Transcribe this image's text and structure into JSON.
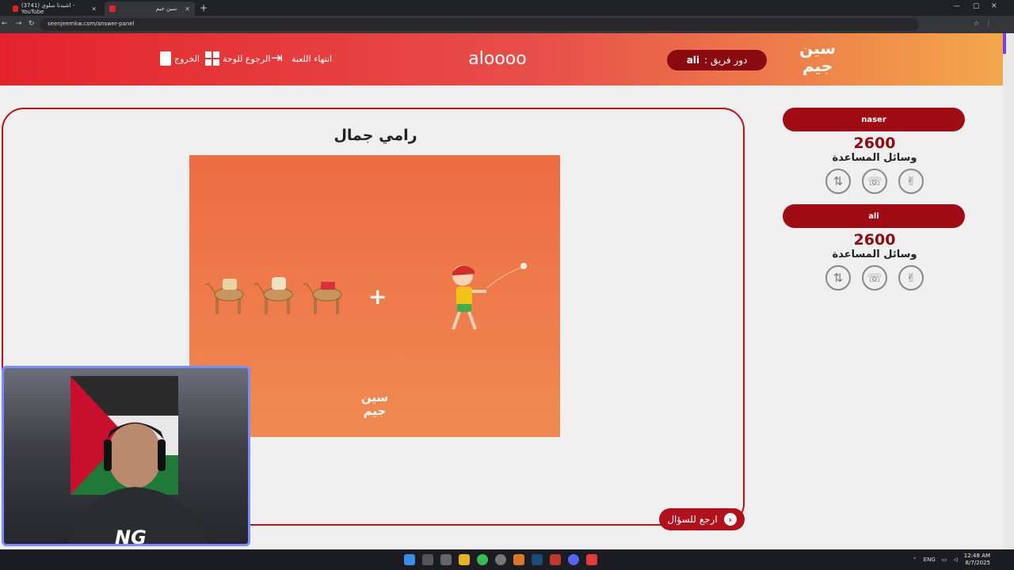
{
  "browser": {
    "tabs": [
      {
        "label": "(3741) اشيدنا سلوي - YouTube",
        "active": false
      },
      {
        "label": "سين جيم",
        "active": true
      }
    ],
    "url": "seenjeemkw.com/answer-panel"
  },
  "header": {
    "logo_text": "سين جيم",
    "turn_label": "دور فريق :",
    "turn_team": "ali",
    "game_name": "aloooo",
    "end_game": "انتهاء اللعبة",
    "back_to_board": "الرجوع للوحة",
    "exit": "الخروج"
  },
  "question": {
    "answer": "رامي جمال",
    "plus_sign": "+",
    "image_logo": "سين جيم",
    "back_button": "ارجع للسؤال"
  },
  "teams": [
    {
      "name": "naser",
      "score": "2600",
      "aids_label": "وسائل المساعدة"
    },
    {
      "name": "ali",
      "score": "2600",
      "aids_label": "وسائل المساعدة"
    }
  ],
  "webcam": {
    "logo": "NG"
  },
  "taskbar": {
    "language": "ENG",
    "time": "12:48 AM",
    "date": "8/7/2025"
  },
  "colors": {
    "accent": "#e3242b",
    "dark_red": "#a00c14",
    "score": "#8e0b12"
  }
}
